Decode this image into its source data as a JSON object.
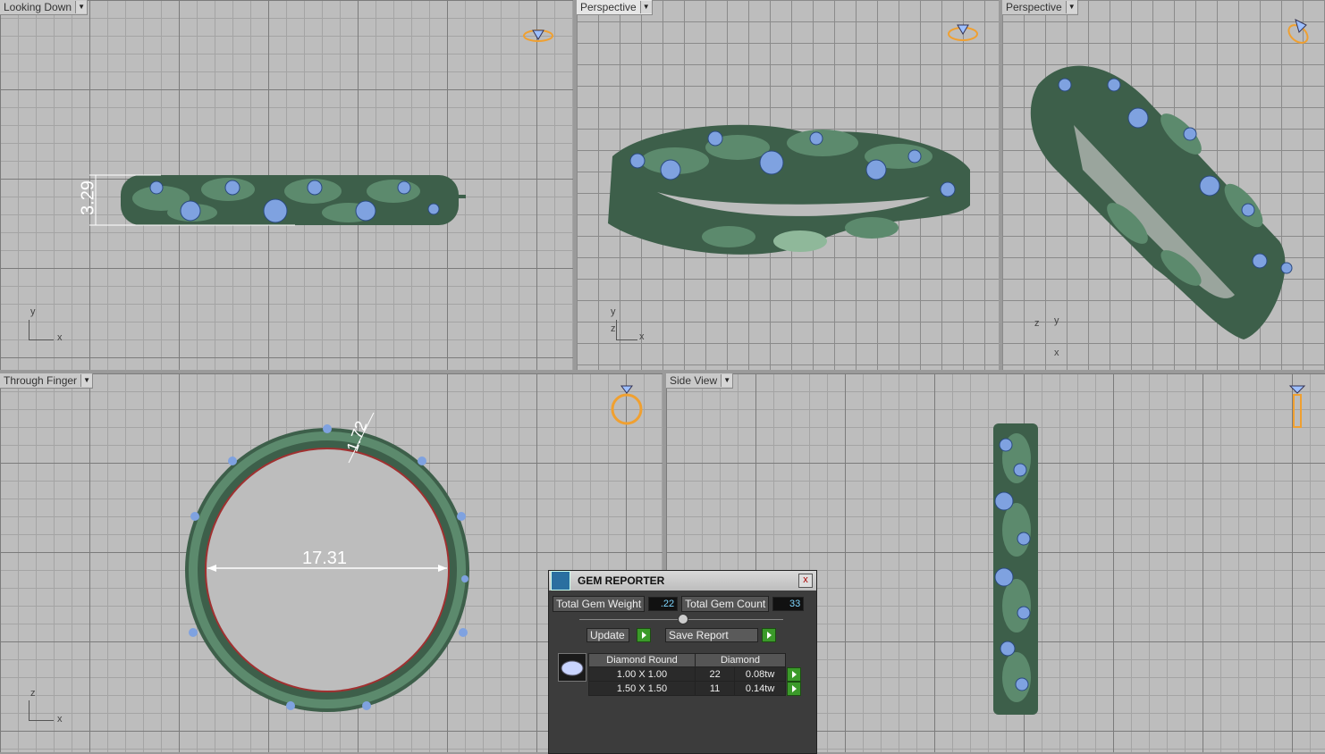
{
  "viewports": [
    {
      "label": "Looking Down",
      "active": false,
      "axes": [
        "y",
        "x"
      ]
    },
    {
      "label": "Perspective",
      "active": true,
      "axes": [
        "y",
        "z",
        "x"
      ]
    },
    {
      "label": "Perspective",
      "active": false,
      "axes": [
        "z",
        "y",
        "x"
      ]
    },
    {
      "label": "Through Finger",
      "active": false,
      "axes": [
        "z",
        "x"
      ]
    },
    {
      "label": "Side View",
      "active": false,
      "axes": []
    }
  ],
  "dimensions": {
    "height": "3.29",
    "thickness": "1.72",
    "inner_diameter": "17.31"
  },
  "gem_reporter": {
    "title": "GEM REPORTER",
    "close": "x",
    "total_weight_label": "Total Gem Weight",
    "total_weight_value": ".22",
    "total_count_label": "Total Gem Count",
    "total_count_value": "33",
    "update_label": "Update",
    "save_label": "Save Report",
    "table_headers": [
      "Diamond Round",
      "Diamond"
    ],
    "rows": [
      {
        "size": "1.00 X 1.00",
        "count": "22",
        "weight": "0.08tw"
      },
      {
        "size": "1.50 X 1.50",
        "count": "11",
        "weight": "0.14tw"
      }
    ]
  },
  "colors": {
    "metal": "#3d5f4a",
    "gem": "#7fa2e0",
    "accent": "#f0a030"
  }
}
